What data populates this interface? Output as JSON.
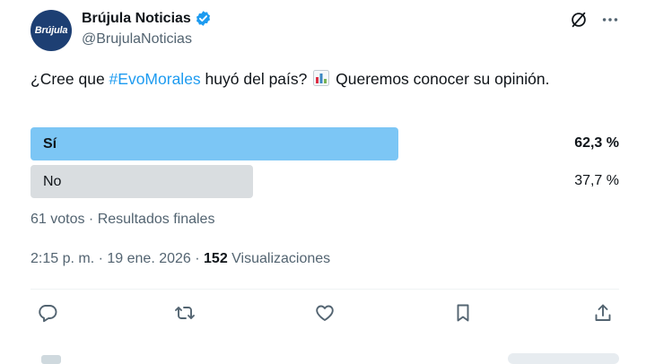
{
  "account": {
    "avatar_text": "Brújula",
    "name": "Brújula Noticias",
    "handle": "@BrujulaNoticias"
  },
  "tweet": {
    "text_before": "¿Cree que ",
    "hashtag": "#EvoMorales",
    "text_after": " huyó del país? ",
    "text_end": " Queremos conocer su opinión."
  },
  "poll": {
    "options": [
      {
        "label": "Sí",
        "percent_text": "62,3 %",
        "percent": 62.3
      },
      {
        "label": "No",
        "percent_text": "37,7 %",
        "percent": 37.7
      }
    ],
    "summary": "61 votos · Resultados finales"
  },
  "meta": {
    "time": "2:15 p. m.",
    "separator1": " · ",
    "date": "19 ene. 2026",
    "separator2": " · ",
    "views_count": "152",
    "views_label": " Visualizaciones"
  },
  "icons": {
    "verified": "verified-badge-icon",
    "grok": "grok-icon",
    "more": "more-icon",
    "reply": "reply-icon",
    "retweet": "retweet-icon",
    "like": "like-icon",
    "bookmark": "bookmark-icon",
    "share": "share-icon",
    "chart_emoji": "bar-chart-emoji-icon"
  },
  "colors": {
    "accent": "#1d9bf0",
    "poll_winner": "#7cc6f5",
    "poll_other": "#d9dde0",
    "avatar_bg": "#1d3f73"
  }
}
